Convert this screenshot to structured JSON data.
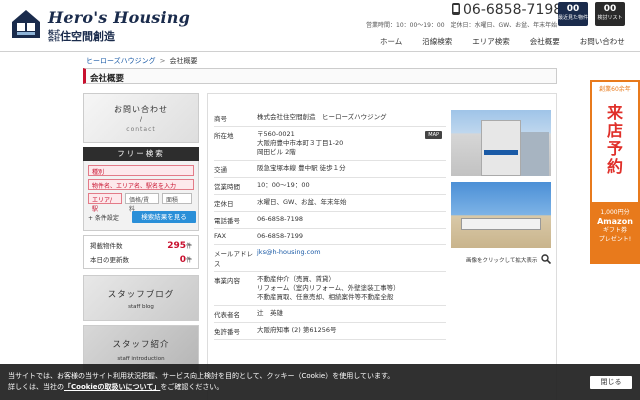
{
  "header": {
    "brand": "Hero's Housing",
    "brand_sub_small": "株式会社",
    "brand_sub": "住空間創造",
    "phone": "06-6858-7198",
    "hours": "営業時間：10：00〜19：00　定休日：水曜日、GW、お盆、年末年始",
    "recent_count": "00",
    "recent_label": "最近見た物件",
    "compare_count": "00",
    "compare_label": "検討リスト",
    "nav": [
      "ホーム",
      "沿線検索",
      "エリア検索",
      "会社概要",
      "お問い合わせ"
    ]
  },
  "breadcrumb": {
    "home": "ヒーローズハウジング",
    "current": "会社概要"
  },
  "page_title": "会社概要",
  "sidebar": {
    "contact_title": "お問い合わせ",
    "contact_slash": "/",
    "contact_en": "contact",
    "search_head": "フリー検索",
    "type_select": "種別",
    "keyword_placeholder": "物件名、エリア名、駅名を入力",
    "area_select": "エリア/駅",
    "price_select": "価格/賃料",
    "size_select": "面積",
    "conditions": "+ 条件設定",
    "search_button": "検索結果を見る",
    "listed_label": "掲載物件数",
    "listed_value": "295",
    "listed_unit": "件",
    "today_label": "本日の更新数",
    "today_value": "0",
    "today_unit": "件",
    "blog_title": "スタッフブログ",
    "blog_en": "staff blog",
    "intro_title": "スタッフ紹介",
    "intro_en": "staff introduction"
  },
  "company": {
    "rows": [
      {
        "k": "商号",
        "v": "株式会社住空間創造　ヒーローズハウジング"
      },
      {
        "k": "所在地",
        "v": "〒560-0021\n大阪府豊中市本町３丁目1-20\n岡田ビル 2階"
      },
      {
        "k": "交通",
        "v": "阪急宝塚本線 豊中駅 徒歩１分"
      },
      {
        "k": "営業時間",
        "v": "10：00〜19：00"
      },
      {
        "k": "定休日",
        "v": "水曜日、GW、お盆、年末年始"
      },
      {
        "k": "電話番号",
        "v": "06-6858-7198"
      },
      {
        "k": "FAX",
        "v": "06-6858-7199"
      },
      {
        "k": "メールアドレス",
        "v": "jks@h-housing.com"
      },
      {
        "k": "事業内容",
        "v": "不動産仲介（売買、賃貸）\nリフォーム（室内リフォーム、外壁塗装工事等）\n不動産買取、任意売却、相続案件等不動産全般"
      },
      {
        "k": "代表者名",
        "v": "辻　英雄"
      },
      {
        "k": "免許番号",
        "v": "大阪府知事 (2) 第61256号"
      }
    ],
    "map_button": "MAP",
    "photo_caption": "画像をクリックして拡大表示"
  },
  "right_banner": {
    "top": "創業60余年",
    "big": "来店予約",
    "gift_line1": "1,000円分",
    "gift_amz": "Amazon",
    "gift_line2": "ギフト券",
    "gift_line3": "プレゼント!"
  },
  "cookie": {
    "line1": "当サイトでは、お客様の当サイト利用状況把握、サービス向上検討を目的として、クッキー（Cookie）を使用しています。",
    "line2_pre": "詳しくは、当社の",
    "link": "「Cookieの取扱いについて」",
    "line2_post": "をご確認ください。",
    "close": "閉じる"
  },
  "colors": {
    "brand": "#1a2b4c",
    "accent": "#c8102e",
    "link": "#1a5aa6",
    "search_button": "#2a8fd8",
    "orange": "#e87a1c"
  }
}
